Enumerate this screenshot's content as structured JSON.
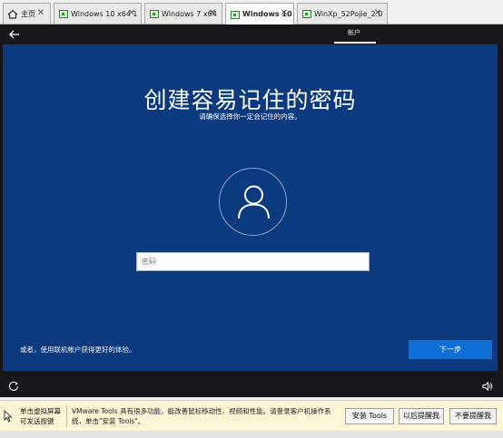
{
  "tabs": [
    {
      "label": "主页"
    },
    {
      "label": "Windows 10 x64 1"
    },
    {
      "label": "Windows 7 x64"
    },
    {
      "label": "Windows 10"
    },
    {
      "label": "WinXp_52Pojie_2.0"
    }
  ],
  "top_nav": {
    "account_tab": "帐户"
  },
  "page": {
    "title": "创建容易记住的密码",
    "subtitle": "请确保选择你一定会记住的内容。",
    "password_placeholder": "密码",
    "alt_link": "或者，使用联机帐户获得更好的体验。",
    "next_button": "下一步"
  },
  "notification": {
    "hint": "单击虚拟屏幕\n可发送按键",
    "message": "VMware Tools 具有很多功能，能改善鼠标移动性、视频和性能。请登录客户机操作系统，单击\"安装 Tools\"。",
    "install_button": "安装 Tools",
    "remind_later_button": "以后提醒我",
    "dont_remind_button": "不要提醒我"
  },
  "icons": {
    "home": "home-icon",
    "vm": "vm-icon",
    "close": "close-icon",
    "back": "back-arrow-icon",
    "user": "user-icon",
    "ease_of_access": "ease-of-access-icon",
    "volume": "volume-icon",
    "cursor": "cursor-icon"
  },
  "colors": {
    "oobe_background": "#0c3a7e",
    "primary_button": "#0f6fd6",
    "notification_background": "#fcf7d6"
  }
}
